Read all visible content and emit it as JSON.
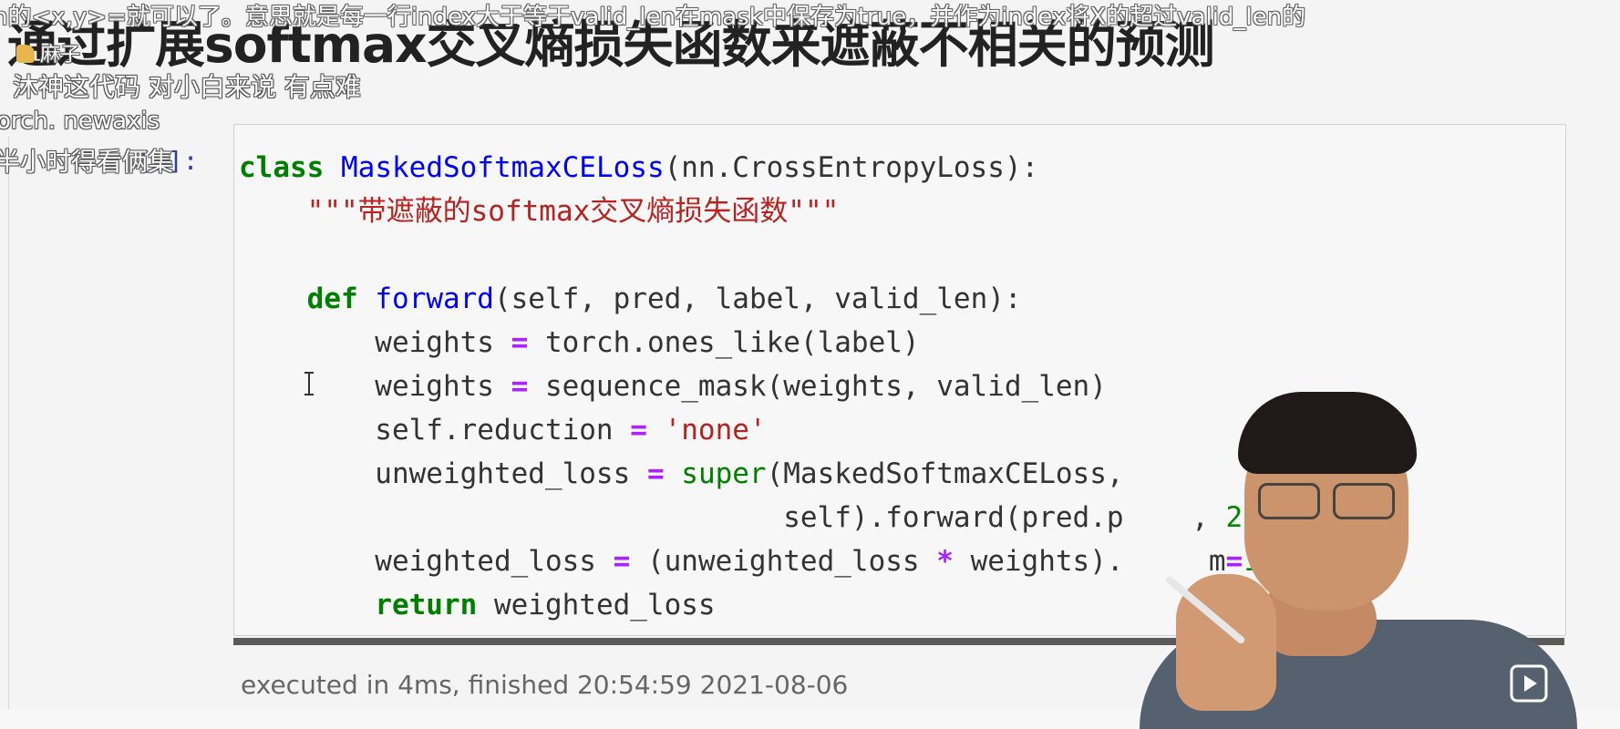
{
  "danmaku": {
    "line1": "n的<x,y>=就可以了。意思就是每一行index大于等于valid_len在mask中保存为true，并作为index将X的超过valid_len的",
    "username": "麻子",
    "comment1": "沐神这代码 对小白来说 有点难",
    "comment2": "orch. newaxis",
    "comment3": "半小时得看俩集"
  },
  "slide": {
    "title": "通过扩展softmax交叉熵损失函数来遮蔽不相关的预测"
  },
  "cell": {
    "prompt": "[9]:",
    "code_lines": [
      "class MaskedSoftmaxCELoss(nn.CrossEntropyLoss):",
      "    \"\"\"带遮蔽的softmax交叉熵损失函数\"\"\"",
      "",
      "    def forward(self, pred, label, valid_len):",
      "        weights = torch.ones_like(label)",
      "        weights = sequence_mask(weights, valid_len)",
      "        self.reduction = 'none'",
      "        unweighted_loss = super(MaskedSoftmaxCELoss,",
      "                                self).forward(pred.p    , 2, 1)",
      "        weighted_loss = (unweighted_loss * weights).     m=1)",
      "        return weighted_loss"
    ],
    "executed_text": "executed in 4ms, finished 20:54:59 2021-08-06"
  },
  "icons": {
    "play": "play-icon",
    "cursor": "text-cursor-icon"
  },
  "colors": {
    "keyword": "#008000",
    "function": "#0000ff",
    "operator": "#aa22ff",
    "string": "#ba2121",
    "prompt": "#303f9f"
  }
}
